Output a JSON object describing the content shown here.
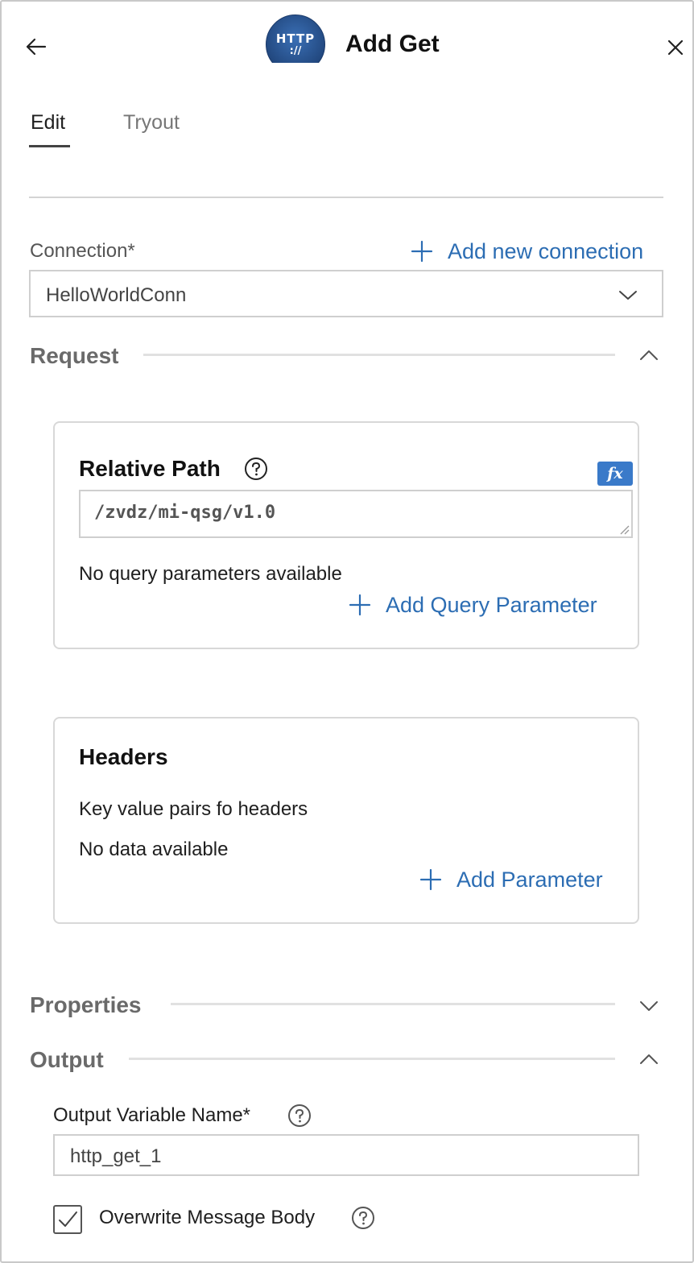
{
  "header": {
    "title": "Add Get",
    "logo_line1": "HTTP",
    "logo_line2": "://"
  },
  "tabs": [
    {
      "label": "Edit",
      "active": true
    },
    {
      "label": "Tryout",
      "active": false
    }
  ],
  "connection": {
    "label": "Connection*",
    "add_label": "Add new connection",
    "selected": "HelloWorldConn"
  },
  "request": {
    "title": "Request",
    "expanded": true,
    "relative_path": {
      "title": "Relative Path",
      "fx_label": "fx",
      "value": "/zvdz/mi-qsg/v1.0",
      "no_params_text": "No query parameters available",
      "add_label": "Add Query Parameter"
    },
    "headers": {
      "title": "Headers",
      "description": "Key value pairs fo headers",
      "empty_text": "No data available",
      "add_label": "Add Parameter"
    }
  },
  "properties": {
    "title": "Properties",
    "expanded": false
  },
  "output": {
    "title": "Output",
    "expanded": true,
    "variable_label": "Output Variable Name*",
    "variable_value": "http_get_1",
    "overwrite_label": "Overwrite Message Body",
    "overwrite_checked": true
  },
  "colors": {
    "accent": "#2c6db3",
    "fx_button": "#3a7ac9",
    "section_title": "#6a6a6a"
  }
}
